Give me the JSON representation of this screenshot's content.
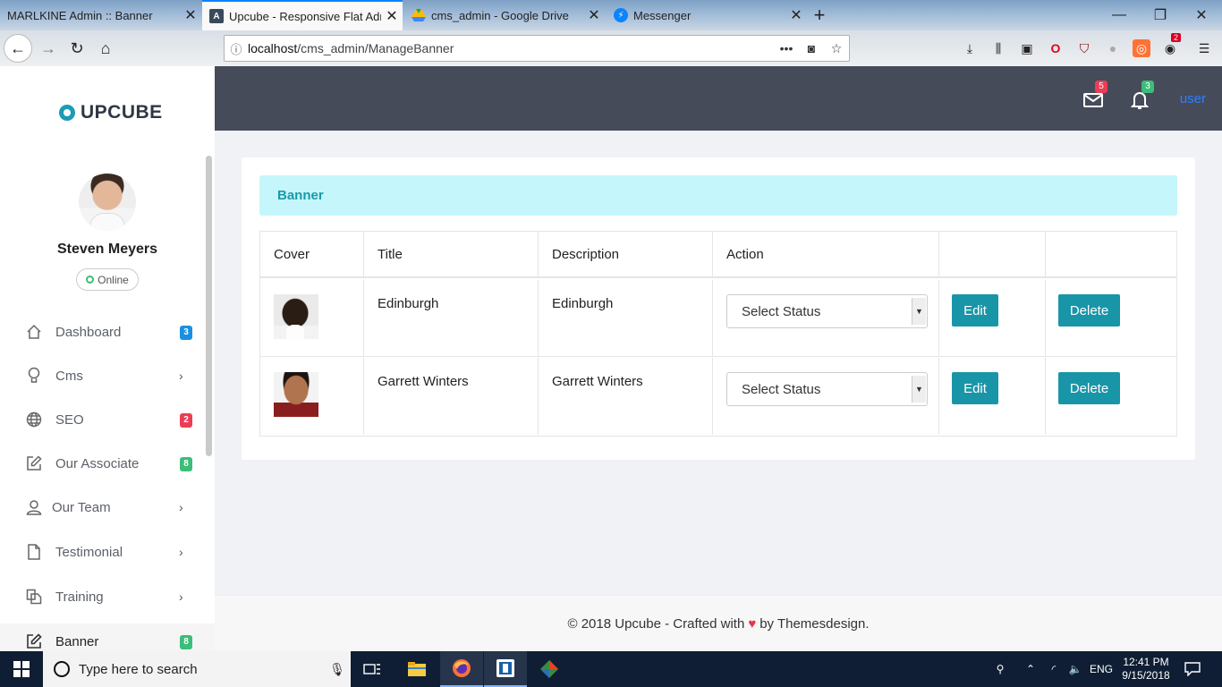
{
  "browser": {
    "tabs": [
      {
        "label": "MARLKINE Admin :: Banner",
        "icon": "page-icon",
        "active": false
      },
      {
        "label": "Upcube - Responsive Flat Adm",
        "icon": "upcube-a-icon",
        "active": true
      },
      {
        "label": "cms_admin - Google Drive",
        "icon": "google-drive-icon",
        "active": false
      },
      {
        "label": "Messenger",
        "icon": "messenger-icon",
        "active": false
      }
    ],
    "url_host": "localhost",
    "url_path": "/cms_admin/ManageBanner",
    "extension_badge": "2"
  },
  "sidebar": {
    "brand": "UPCUBE",
    "user_name": "Steven Meyers",
    "status": "Online",
    "items": [
      {
        "label": "Dashboard",
        "icon": "home-icon",
        "badge": "3",
        "badge_color": "#1b8fe0"
      },
      {
        "label": "Cms",
        "icon": "lightbulb-icon",
        "chevron": "›"
      },
      {
        "label": "SEO",
        "icon": "globe-icon",
        "badge": "2",
        "badge_color": "#ec3d55"
      },
      {
        "label": "Our Associate",
        "icon": "edit-icon",
        "badge": "8",
        "badge_color": "#3cbd78"
      },
      {
        "label": "Our Team",
        "icon": "user-icon",
        "chevron": "›"
      },
      {
        "label": "Testimonial",
        "icon": "file-icon",
        "chevron": "›"
      },
      {
        "label": "Training",
        "icon": "copy-icon",
        "chevron": "›"
      },
      {
        "label": "Banner",
        "icon": "edit-icon",
        "badge": "8",
        "badge_color": "#3cbd78"
      }
    ]
  },
  "topbar": {
    "mail_badge": "5",
    "bell_badge": "3",
    "user_label": "user",
    "accent": "#2f80ff"
  },
  "card": {
    "header": "Banner",
    "columns": [
      "Cover",
      "Title",
      "Description",
      "Action",
      "",
      ""
    ],
    "rows": [
      {
        "cover": "portrait-photo",
        "title": "Edinburgh",
        "description": "Edinburgh",
        "status": "Select Status",
        "edit": "Edit",
        "delete": "Delete"
      },
      {
        "cover": "portrait-photo",
        "title": "Garrett Winters",
        "description": "Garrett Winters",
        "status": "Select Status",
        "edit": "Edit",
        "delete": "Delete"
      }
    ]
  },
  "footer": {
    "before": "© 2018 Upcube - Crafted with",
    "heart": "♥",
    "after": "by Themesdesign."
  },
  "taskbar": {
    "search_placeholder": "Type here to search",
    "lang": "ENG",
    "time": "12:41 PM",
    "date": "9/15/2018"
  }
}
